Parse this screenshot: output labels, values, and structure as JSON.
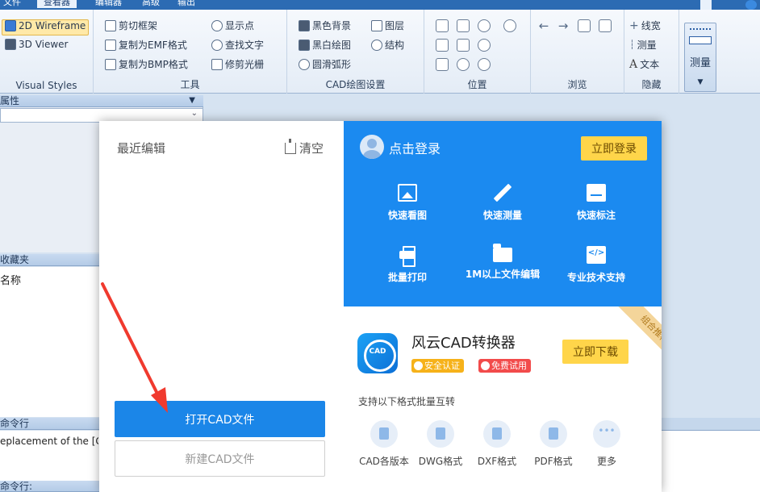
{
  "menubar": {
    "items": [
      "文件",
      "查看器",
      "编辑器",
      "高级",
      "输出"
    ]
  },
  "ribbon": {
    "visual_styles": {
      "items": [
        "2D Wireframe",
        "3D Viewer"
      ],
      "label": "Visual Styles"
    },
    "tools": {
      "items": [
        "剪切框架",
        "复制为EMF格式",
        "复制为BMP格式",
        "显示点",
        "查找文字",
        "修剪光栅"
      ],
      "label": "工具"
    },
    "cad_settings": {
      "items": [
        "黑色背景",
        "黑白绘图",
        "圆滑弧形",
        "图层",
        "结构"
      ],
      "label": "CAD绘图设置"
    },
    "position": {
      "label": "位置"
    },
    "browse": {
      "label": "浏览"
    },
    "hide": {
      "items": [
        "线宽",
        "测量",
        "文本"
      ],
      "label": "隐藏"
    },
    "measure": {
      "label": "测量"
    }
  },
  "panels": {
    "properties": "属性",
    "favorites": "收藏夹",
    "favorites_col": "名称",
    "command_line": "命令行",
    "command_text": "eplacement of the [Ge",
    "command_prompt": "命令行:"
  },
  "dialog": {
    "recent_title": "最近编辑",
    "clear": "清空",
    "open_btn": "打开CAD文件",
    "new_btn": "新建CAD文件",
    "login_text": "点击登录",
    "login_btn": "立即登录",
    "features": [
      "快速看图",
      "快速测量",
      "快速标注",
      "批量打印",
      "1M以上文件编辑",
      "专业技术支持"
    ],
    "product": {
      "name": "风云CAD转换器",
      "logo_text": "CAD",
      "badge_safe": "安全认证",
      "badge_free": "免费试用",
      "download_btn": "立即下载",
      "tag": "组合推荐"
    },
    "support_text": "支持以下格式批量互转",
    "formats": [
      "CAD各版本",
      "DWG格式",
      "DXF格式",
      "PDF格式",
      "更多"
    ]
  }
}
